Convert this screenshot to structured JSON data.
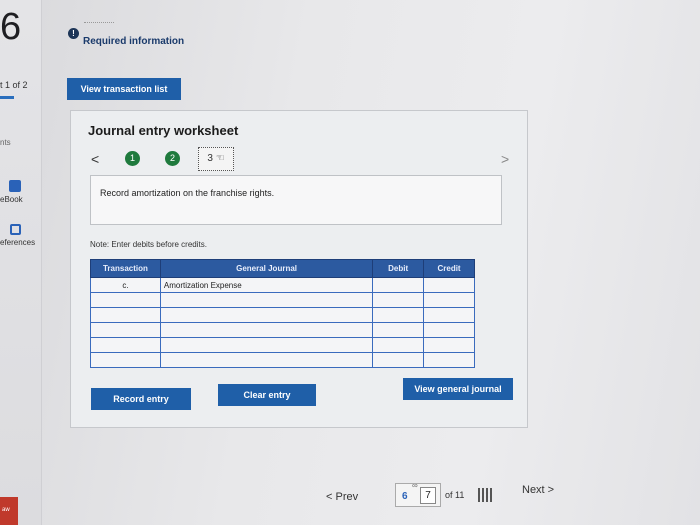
{
  "question": {
    "number": "6",
    "part": "t 1 of 2"
  },
  "sidebar": {
    "points_label": "nts",
    "ebook_label": "eBook",
    "references_label": "eferences",
    "badge_text": "aw"
  },
  "header": {
    "required_label": "Required information",
    "view_transactions_label": "View transaction list"
  },
  "worksheet": {
    "title": "Journal entry worksheet",
    "prev_arrow": "<",
    "next_arrow": ">",
    "steps": [
      "1",
      "2",
      "3"
    ],
    "instruction": "Record amortization on the franchise rights.",
    "note": "Note: Enter debits before credits.",
    "columns": {
      "transaction": "Transaction",
      "general_journal": "General Journal",
      "debit": "Debit",
      "credit": "Credit"
    },
    "rows": [
      {
        "transaction": "c.",
        "account": "Amortization Expense",
        "debit": "",
        "credit": ""
      },
      {
        "transaction": "",
        "account": "",
        "debit": "",
        "credit": ""
      },
      {
        "transaction": "",
        "account": "",
        "debit": "",
        "credit": ""
      },
      {
        "transaction": "",
        "account": "",
        "debit": "",
        "credit": ""
      },
      {
        "transaction": "",
        "account": "",
        "debit": "",
        "credit": ""
      },
      {
        "transaction": "",
        "account": "",
        "debit": "",
        "credit": ""
      }
    ],
    "record_entry_label": "Record entry",
    "clear_entry_label": "Clear entry",
    "view_general_journal_label": "View general journal"
  },
  "footer": {
    "prev_label": "< Prev",
    "prev_page": "6",
    "current_page": "7",
    "of_total": "of 11",
    "next_label": "Next >"
  },
  "colors": {
    "accent": "#1f5fa8",
    "table_header": "#2c5aa0",
    "step_done": "#1f7a3d"
  }
}
